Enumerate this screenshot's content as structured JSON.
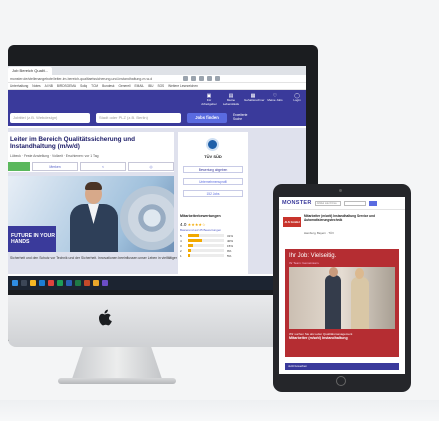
{
  "browser": {
    "tab_title": "Job Bereich Qualit...",
    "url": "monster.de/stellenangebote/leiter-im-bereich-qualitaetssicherung-und-instandhaltung-m-w-d",
    "bookmarks": [
      "Unterhaltung",
      "Notes",
      "AI NB",
      "BIRDSGEMA",
      "Soliq",
      "TCM",
      "Bundesk",
      "Generell",
      "EMAIL",
      "IBU",
      "SOS",
      "Weitere Lesezeichen"
    ]
  },
  "site_header": {
    "items": [
      {
        "label": "Für Arbeitgeber",
        "icon": "briefcase-icon"
      },
      {
        "label": "Meine Lebensläufe",
        "icon": "document-icon"
      },
      {
        "label": "Gehaltsrechner",
        "icon": "calculator-icon"
      },
      {
        "label": "Meine Jobs",
        "icon": "heart-icon"
      },
      {
        "label": "Login",
        "icon": "user-icon"
      }
    ]
  },
  "search": {
    "what_placeholder": "Jobtitel (z.B. Webdesign)",
    "where_placeholder": "Stadt oder PLZ (z.B. Berlin)",
    "button": "Jobs finden",
    "advanced": "Erweiterte Suche"
  },
  "job": {
    "title": "Leiter im Bereich Qualitätssicherung und Instandhaltung (m/w/d)",
    "meta": "Lübeck  ·  Feste Anstellung  ·  Vollzeit  ·  Erschienen: vor 1 Tag",
    "save_label": "Merken",
    "share_label": "Teilen"
  },
  "hero": {
    "tagline": "FUTURE IN YOUR HANDS"
  },
  "footer_text": "Sicherheit und den Schutz vor Technik und der Sicherheit. Innovationen beeinflussen unser Leben in vielfältiger Weise.",
  "company": {
    "name": "TÜV SÜD",
    "btn_reviews": "Bewertung abgeben",
    "btn_profile": "Unternehmensprofil",
    "btn_jobs": "152 Jobs"
  },
  "reviews": {
    "title": "Mitarbeiterbewertungen",
    "score": "4.0",
    "stars": "★★★★☆",
    "sub": "Basierend auf 25 Bewertungen",
    "rows": [
      {
        "label": "5",
        "percent": 31,
        "pct_label": "31%"
      },
      {
        "label": "4",
        "percent": 40,
        "pct_label": "40%"
      },
      {
        "label": "3",
        "percent": 15,
        "pct_label": "15%"
      },
      {
        "label": "2",
        "percent": 9,
        "pct_label": "9%"
      },
      {
        "label": "1",
        "percent": 5,
        "pct_label": "5%"
      }
    ]
  },
  "tablet": {
    "logo": "MONSTER",
    "search_placeholder": "Jobtitel oder Firma",
    "job_logo": "JLS GmbH",
    "job_title": "Mitarbeiter (m/w/d) Instandhaltung Service und Automatisierungstechnik",
    "job_location": "Hamburg, Bayern · TÜV",
    "ad_head": "Ihr Job: Vielseitig.",
    "ad_sub": "Ihr Team: Gemeinsam.",
    "ad_text": "Wir suchen Sie als Leiter Qualitätsmanagement",
    "ad_text_bold": "Mitarbeiter (m/w/d) Instandhaltung",
    "bar_text": "Jetzt bewerben"
  },
  "colors": {
    "brand": "#3a3a9b",
    "accent": "#5a6be0",
    "apply_green": "#5bb85d",
    "star": "#f2a900",
    "ad_red": "#b52d32"
  }
}
